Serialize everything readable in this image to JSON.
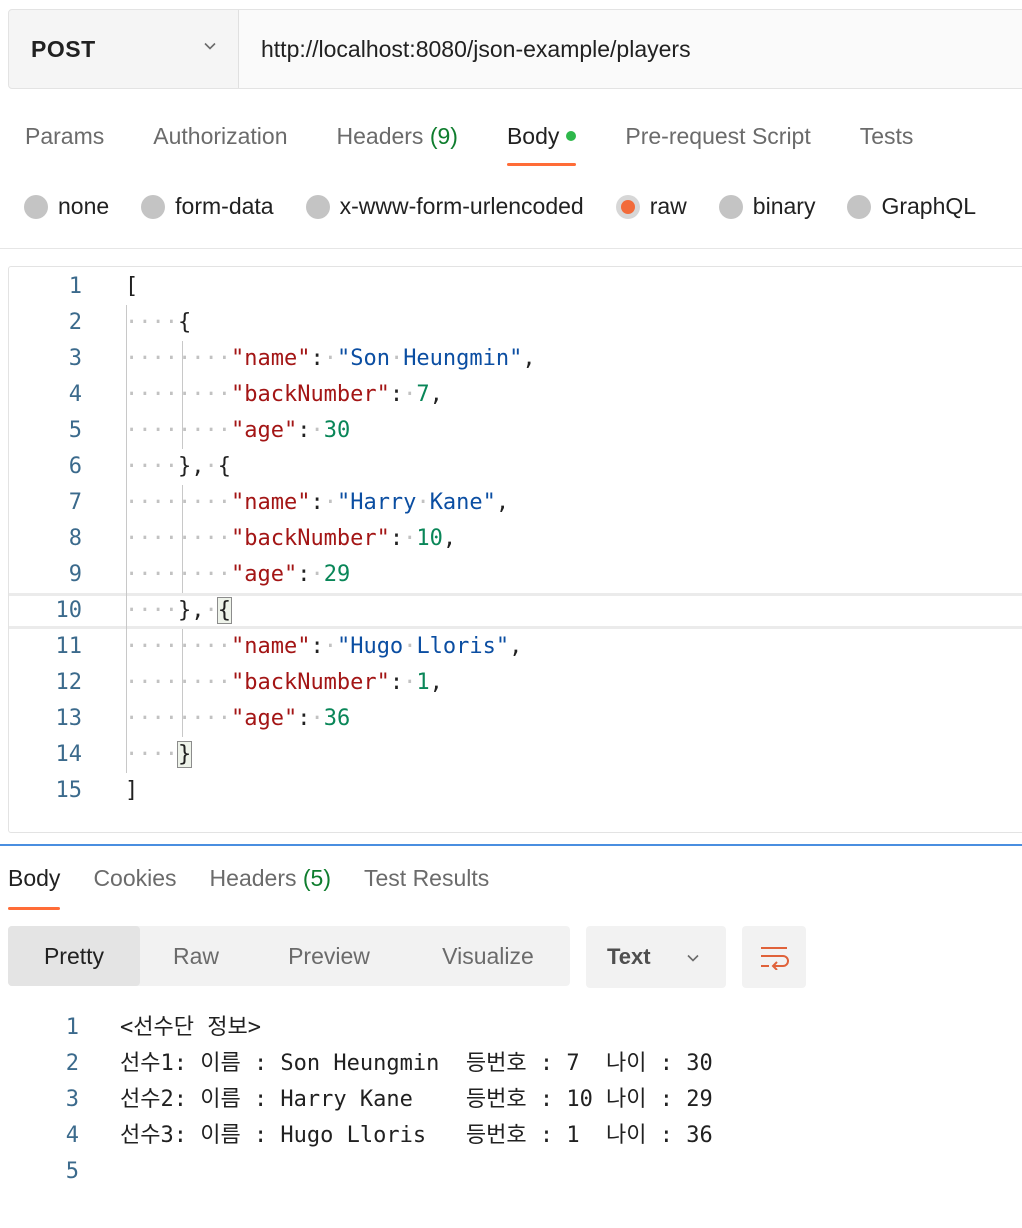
{
  "request": {
    "method": "POST",
    "url": "http://localhost:8080/json-example/players"
  },
  "request_tabs": [
    {
      "label": "Params"
    },
    {
      "label": "Authorization"
    },
    {
      "label": "Headers",
      "count": "(9)"
    },
    {
      "label": "Body",
      "active": true,
      "indicator_color": "#2eb84b"
    },
    {
      "label": "Pre-request Script"
    },
    {
      "label": "Tests"
    }
  ],
  "body_types": [
    {
      "label": "none"
    },
    {
      "label": "form-data"
    },
    {
      "label": "x-www-form-urlencoded"
    },
    {
      "label": "raw",
      "selected": true
    },
    {
      "label": "binary"
    },
    {
      "label": "GraphQL"
    }
  ],
  "editor": {
    "current_line": 10,
    "lines": [
      {
        "num": "1",
        "text": "["
      },
      {
        "num": "2",
        "text": "    {"
      },
      {
        "num": "3",
        "text": "        \"name\": \"Son Heungmin\","
      },
      {
        "num": "4",
        "text": "        \"backNumber\": 7,"
      },
      {
        "num": "5",
        "text": "        \"age\": 30"
      },
      {
        "num": "6",
        "text": "    }, {"
      },
      {
        "num": "7",
        "text": "        \"name\": \"Harry Kane\","
      },
      {
        "num": "8",
        "text": "        \"backNumber\": 10,"
      },
      {
        "num": "9",
        "text": "        \"age\": 29"
      },
      {
        "num": "10",
        "text": "    }, {"
      },
      {
        "num": "11",
        "text": "        \"name\": \"Hugo Lloris\","
      },
      {
        "num": "12",
        "text": "        \"backNumber\": 1,"
      },
      {
        "num": "13",
        "text": "        \"age\": 36"
      },
      {
        "num": "14",
        "text": "    }"
      },
      {
        "num": "15",
        "text": "]"
      }
    ]
  },
  "response_tabs": [
    {
      "label": "Body",
      "active": true
    },
    {
      "label": "Cookies"
    },
    {
      "label": "Headers",
      "count": "(5)"
    },
    {
      "label": "Test Results"
    }
  ],
  "format_modes": [
    {
      "label": "Pretty",
      "active": true
    },
    {
      "label": "Raw"
    },
    {
      "label": "Preview"
    },
    {
      "label": "Visualize"
    }
  ],
  "format_select": {
    "value": "Text"
  },
  "wrap_icon": "wrap-lines-icon",
  "accent_color": "#ff6c37",
  "response_lines": [
    {
      "num": "1",
      "text": "<선수단 정보>"
    },
    {
      "num": "2",
      "text": "선수1: 이름 : Son Heungmin  등번호 : 7  나이 : 30"
    },
    {
      "num": "3",
      "text": "선수2: 이름 : Harry Kane    등번호 : 10 나이 : 29"
    },
    {
      "num": "4",
      "text": "선수3: 이름 : Hugo Lloris   등번호 : 1  나이 : 36"
    },
    {
      "num": "5",
      "text": ""
    }
  ]
}
